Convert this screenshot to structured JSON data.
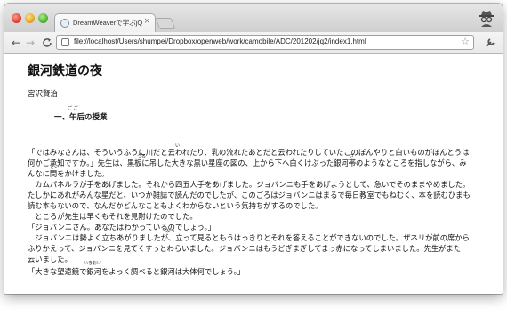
{
  "browser": {
    "tab_title": "DreamWeaverで学ぶjQuery/",
    "tab_close": "×",
    "url": "file://localhost/Users/shumpei/Dropbox/openweb/work/camobile/ADC/201202/jq2/index1.html",
    "back": "←",
    "forward": "→",
    "reload": "C",
    "star": "☆",
    "wrench": "🔧"
  },
  "page": {
    "title": "銀河鉄道の夜",
    "author": "宮沢賢治",
    "chapter": "一、午后の授業",
    "ruby_gogo": "ご ご",
    "ruby_i": "い",
    "ruby_tsuru": "つる",
    "ruby_sashi": "さ",
    "ruby_toi": "とい",
    "ruby_ikioi": "いきおい",
    "ruby_mitsu": "みつ",
    "paragraphs": [
      "「ではみなさんは、そういうふうに川だと云われたり、乳の流れたあとだと云われたりしていたこのぼんやりと白いものがほんとうは",
      "何かご承知ですか。」先生は、黒板に吊した大きな黒い星座の図の、上から下へ白くけぶった銀河帯のようなところを指しながら、み",
      "んなに問をかけました。",
      "　カムパネルラが手をあげました。それから四五人手をあげました。ジョバンニも手をあげようとして、急いでそのままやめました。",
      "たしかにあれがみんな星だと、いつか雑誌で読んだのでしたが、このごろはジョバンニはまるで毎日教室でもねむく、本を読むひまも",
      "読む本もないので、なんだかどんなこともよくわからないという気持ちがするのでした。",
      "　ところが先生は早くもそれを見附けたのでした。",
      "「ジョバンニさん。あなたはわかっているのでしょう。」",
      "　ジョバンニは勢よく立ちあがりましたが、立って見るともうはっきりとそれを答えることができないのでした。ザネリが前の席から",
      "ふりかえって、ジョバンニを見てくすっとわらいました。ジョバンニはもうどぎまぎしてまっ赤になってしまいました。先生がまた",
      "云いました。",
      "「大きな望遠鏡で銀河をよっく調べると銀河は大体何でしょう。」"
    ]
  }
}
